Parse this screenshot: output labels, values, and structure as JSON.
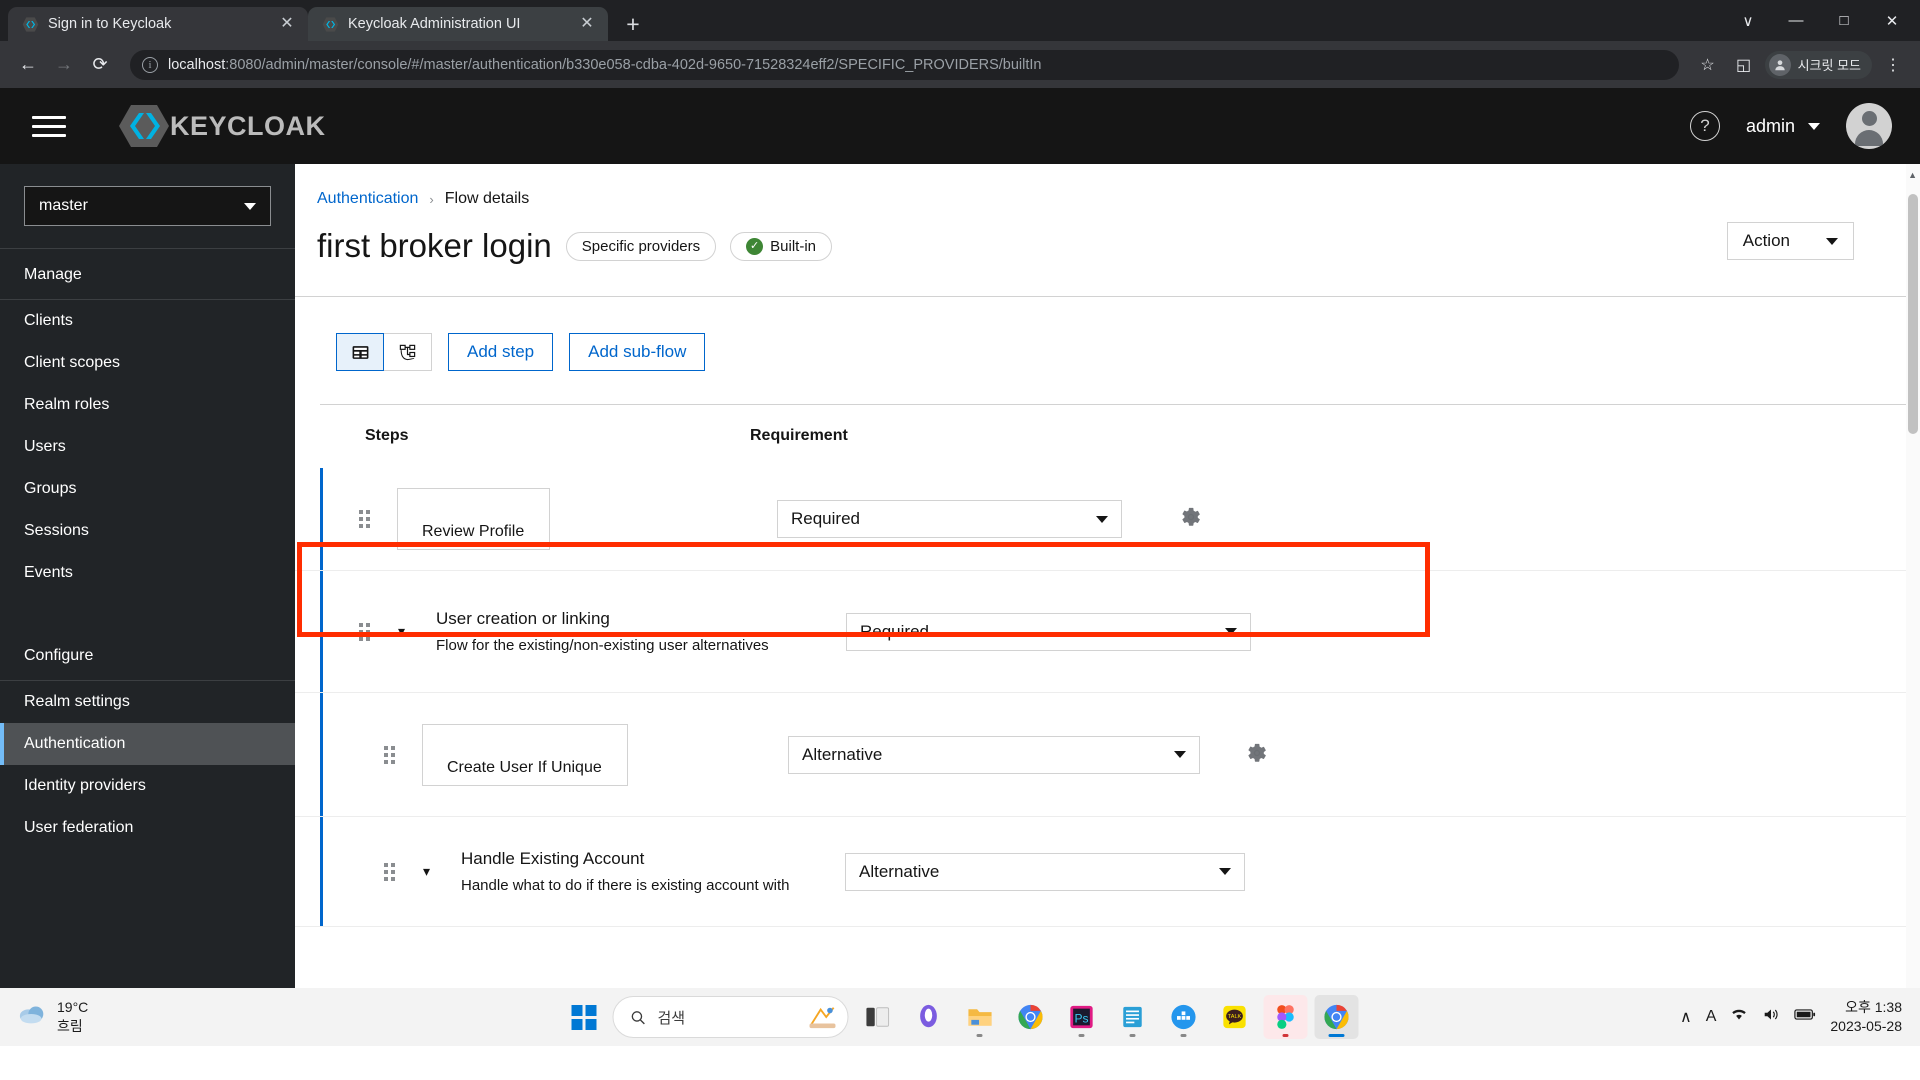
{
  "browser": {
    "tabs": [
      {
        "title": "Sign in to Keycloak",
        "favicon": "keycloak-icon",
        "close": "✕",
        "active": false
      },
      {
        "title": "Keycloak Administration UI",
        "favicon": "keycloak-icon",
        "close": "✕",
        "active": true
      }
    ],
    "new_tab_label": "+",
    "window_controls": {
      "minimize": "—",
      "maximize": "□",
      "close": "✕",
      "expand": "∨"
    },
    "nav": {
      "back": "←",
      "forward": "→",
      "reload": "⟳"
    },
    "omnibox": {
      "info_glyph": "i",
      "host": "localhost",
      "path": ":8080/admin/master/console/#/master/authentication/b330e058-cdba-402d-9650-71528324eff2/SPECIFIC_PROVIDERS/builtIn",
      "star": "☆",
      "sidepanel": "◱",
      "menu": "⋮"
    },
    "profile": {
      "label": "시크릿 모드",
      "avatar_glyph": "●"
    }
  },
  "keycloak": {
    "header": {
      "brand": "KEYCLOAK",
      "hamburger": "menu-icon",
      "help_glyph": "?",
      "user_label": "admin"
    },
    "sidebar": {
      "realm_selected": "master",
      "groups": [
        {
          "label": "Manage",
          "items": [
            "Clients",
            "Client scopes",
            "Realm roles",
            "Users",
            "Groups",
            "Sessions",
            "Events"
          ]
        },
        {
          "label": "Configure",
          "items": [
            "Realm settings",
            "Authentication",
            "Identity providers",
            "User federation"
          ]
        }
      ],
      "active_item": "Authentication"
    },
    "breadcrumb": {
      "parent": "Authentication",
      "separator": "›",
      "current": "Flow details"
    },
    "page": {
      "title": "first broker login",
      "badges": [
        {
          "text": "Specific providers",
          "icon": null
        },
        {
          "text": "Built-in",
          "icon": "check-circle-icon"
        }
      ],
      "action_button": "Action"
    },
    "toolbar": {
      "view_table_icon": "table-view-icon",
      "view_diagram_icon": "diagram-view-icon",
      "add_step": "Add step",
      "add_subflow": "Add sub-flow"
    },
    "table": {
      "columns": [
        "Steps",
        "Requirement"
      ],
      "rows": [
        {
          "type": "step",
          "name": "Review Profile",
          "description": null,
          "requirement": "Required",
          "has_gear": true,
          "has_chevron": false,
          "indent": 0,
          "highlighted": true
        },
        {
          "type": "subflow",
          "name": "User creation or linking",
          "description": "Flow for the existing/non-existing user alternatives",
          "requirement": "Required",
          "has_gear": false,
          "has_chevron": true,
          "indent": 0,
          "highlighted": false
        },
        {
          "type": "step",
          "name": "Create User If Unique",
          "description": null,
          "requirement": "Alternative",
          "has_gear": true,
          "has_chevron": false,
          "indent": 1,
          "highlighted": false
        },
        {
          "type": "subflow",
          "name": "Handle Existing Account",
          "description": "Handle what to do if there is existing account with",
          "requirement": "Alternative",
          "has_gear": false,
          "has_chevron": true,
          "indent": 1,
          "highlighted": false
        }
      ]
    },
    "colors": {
      "accent": "#0066cc",
      "highlight": "#ff2d00",
      "sidebar_bg": "#212427",
      "header_bg": "#151515",
      "success": "#3e8635"
    }
  },
  "taskbar": {
    "weather": {
      "temp": "19°C",
      "condition": "흐림",
      "icon": "cloud-icon"
    },
    "start_label": "start-button",
    "search_placeholder": "검색",
    "search_icon": "search-icon",
    "apps": [
      "widgets-icon",
      "task-view-icon",
      "chat-icon",
      "file-explorer-icon",
      "chrome-icon",
      "photoshop-icon",
      "notes-icon",
      "docker-icon",
      "kakaotalk-icon",
      "figma-icon",
      "chrome-active-icon"
    ],
    "system": {
      "chevron": "∧",
      "ime": "A",
      "wifi": "wifi-icon",
      "volume": "volume-icon",
      "battery": "battery-icon"
    },
    "clock": {
      "time": "오후 1:38",
      "date": "2023-05-28"
    }
  }
}
